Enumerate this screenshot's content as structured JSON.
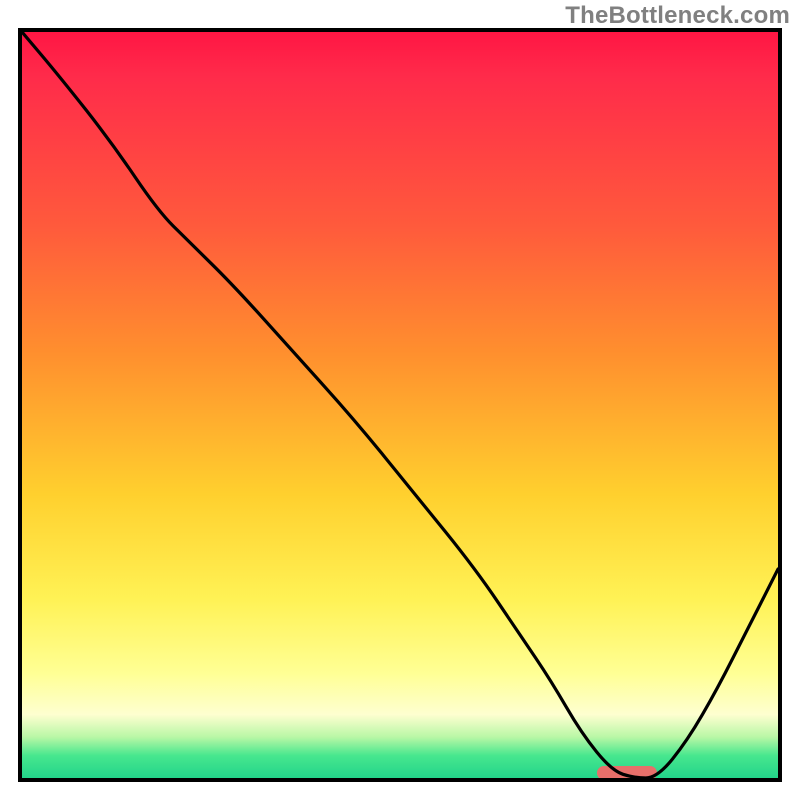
{
  "watermark": "TheBottleneck.com",
  "colors": {
    "frame": "#000000",
    "curve": "#000000",
    "marker": "#e76f6a",
    "gradient_top": "#ff1644",
    "gradient_mid_orange": "#ff8f2e",
    "gradient_mid_yellow": "#fff255",
    "gradient_bottom": "#23d48a"
  },
  "chart_data": {
    "type": "line",
    "title": "",
    "xlabel": "",
    "ylabel": "",
    "xlim": [
      0,
      100
    ],
    "ylim": [
      0,
      100
    ],
    "x": [
      0,
      5,
      12,
      18,
      22,
      28,
      36,
      44,
      52,
      60,
      66,
      70,
      74,
      78,
      81,
      84,
      88,
      92,
      96,
      100
    ],
    "y": [
      100,
      94,
      85,
      76,
      72,
      66,
      57,
      48,
      38,
      28,
      19,
      13,
      6,
      1,
      0,
      0,
      5,
      12,
      20,
      28
    ],
    "marker": {
      "x_start": 76,
      "x_end": 84,
      "y": 0
    },
    "note": "x and y are in percent of the inner plot area; y=0 at bottom, y=100 at top. Values estimated from pixels; no axis ticks/labels are visible in the image."
  }
}
